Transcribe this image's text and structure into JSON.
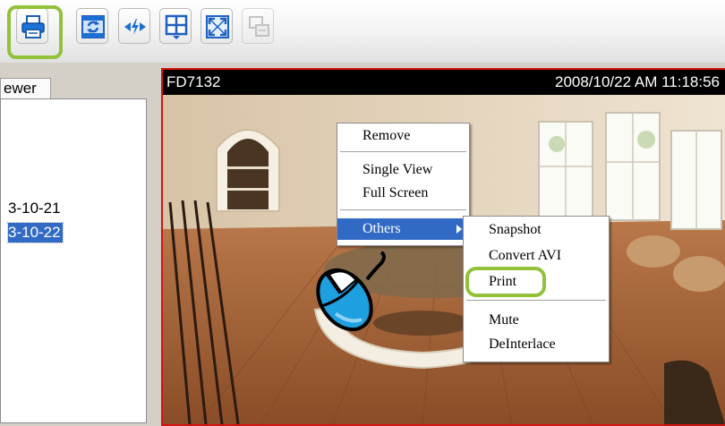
{
  "toolbar": {
    "buttons": [
      {
        "name": "print",
        "icon": "printer-icon",
        "enabled": true
      },
      {
        "name": "refresh",
        "icon": "refresh-icon",
        "enabled": true
      },
      {
        "name": "patrol",
        "icon": "patrol-icon",
        "enabled": true
      },
      {
        "name": "layout",
        "icon": "grid-layout-icon",
        "enabled": true
      },
      {
        "name": "full-screen",
        "icon": "fullscreen-icon",
        "enabled": true
      },
      {
        "name": "switch",
        "icon": "switch-view-icon",
        "enabled": false
      }
    ],
    "highlight_color": "#92c13a"
  },
  "left_panel": {
    "tab_label": "ewer",
    "tree_items": [
      {
        "label": "3-10-21",
        "selected": false
      },
      {
        "label": "3-10-22",
        "selected": true
      }
    ]
  },
  "video": {
    "camera_name": "FD7132",
    "timestamp": "2008/10/22 AM 11:18:56",
    "border_color": "#d41414"
  },
  "context_menu": {
    "items": [
      "Remove",
      "Single View",
      "Full Screen",
      "Others"
    ],
    "highlighted": "Others"
  },
  "submenu": {
    "items": [
      "Snapshot",
      "Convert AVI",
      "Print",
      "Mute",
      "DeInterlace"
    ],
    "circled": "Print"
  },
  "accent_colors": {
    "selection": "#316ac5",
    "callout": "#92c13a",
    "mouse_cursor": "#1e9fe0"
  }
}
